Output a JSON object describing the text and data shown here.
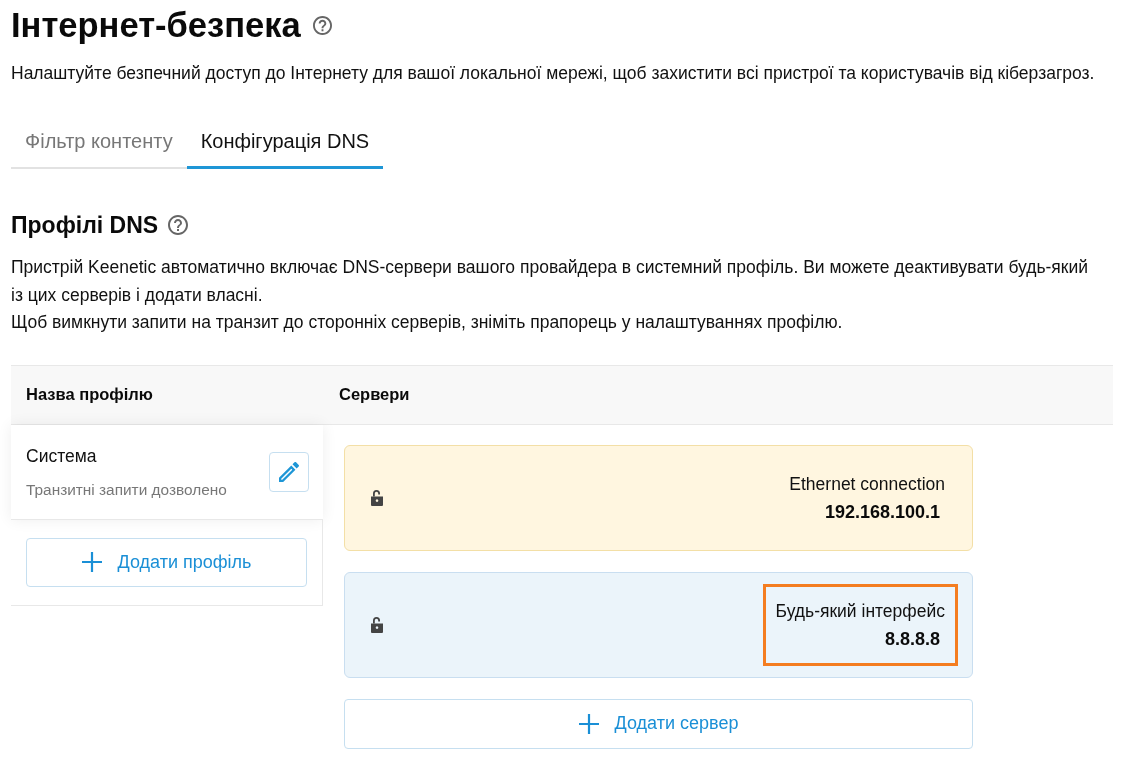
{
  "page": {
    "title": "Інтернет-безпека",
    "description": "Налаштуйте безпечний доступ до Інтернету для вашої локальної мережі, щоб захистити всі пристрої та користувачів від кіберзагроз."
  },
  "tabs": [
    {
      "label": "Фільтр контенту",
      "selected": false
    },
    {
      "label": "Конфігурація DNS",
      "selected": true
    }
  ],
  "section": {
    "title": "Профілі DNS",
    "paragraphs": [
      "Пристрій Keenetic автоматично включає DNS-сервери вашого провайдера в системний профіль. Ви можете деактивувати будь-який із цих серверів і додати власні.",
      "Щоб вимкнути запити на транзит до сторонніх серверів, зніміть прапорець у налаштуваннях профілю."
    ]
  },
  "table": {
    "columns": [
      "Назва профілю",
      "Сервери"
    ],
    "profiles": [
      {
        "name": "Система",
        "note": "Транзитні запити дозволено"
      }
    ],
    "add_profile_button": "Додати профіль",
    "servers": [
      {
        "kind": "provider",
        "interface": "Ethernet connection",
        "address": "192.168.100.1",
        "highlighted": false
      },
      {
        "kind": "custom",
        "interface": "Будь-який інтерфейс",
        "address": "8.8.8.8",
        "highlighted": true
      }
    ],
    "add_server_button": "Додати сервер"
  }
}
